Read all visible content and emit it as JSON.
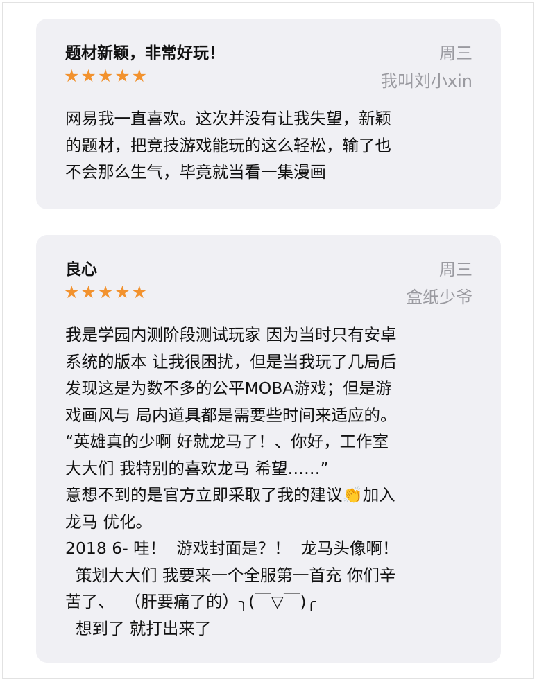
{
  "reviews": [
    {
      "title": "题材新颖，非常好玩！",
      "date": "周三",
      "author": "我叫刘小xin",
      "stars": "★★★★★",
      "body": "网易我一直喜欢。这次并没有让我失望，新颖\n的题材，把竞技游戏能玩的这么轻松，输了也\n不会那么生气，毕竟就当看一集漫画"
    },
    {
      "title": "良心",
      "date": "周三",
      "author": "盒纸少爷",
      "stars": "★★★★★",
      "body": "我是学园内测阶段测试玩家 因为当时只有安卓\n系统的版本 让我很困扰，但是当我玩了几局后\n发现这是为数不多的公平MOBA游戏；但是游\n戏画风与 局内道具都是需要些时间来适应的。\n“英雄真的少啊 好就龙马了！、你好，工作室\n大大们 我特别的喜欢龙马 希望……”\n意想不到的是官方立即采取了我的建议👏加入\n龙马 优化。\n2018 6- 哇！  游戏封面是？！  龙马头像啊！\n  策划大大们 我要来一个全服第一首充 你们辛\n苦了、  （肝要痛了的）╮(￣▽￣)╭\n  想到了 就打出来了"
    }
  ],
  "colors": {
    "card_bg": "#f0f0f4",
    "star": "#f2922e",
    "meta_text": "#9a9aa0"
  }
}
